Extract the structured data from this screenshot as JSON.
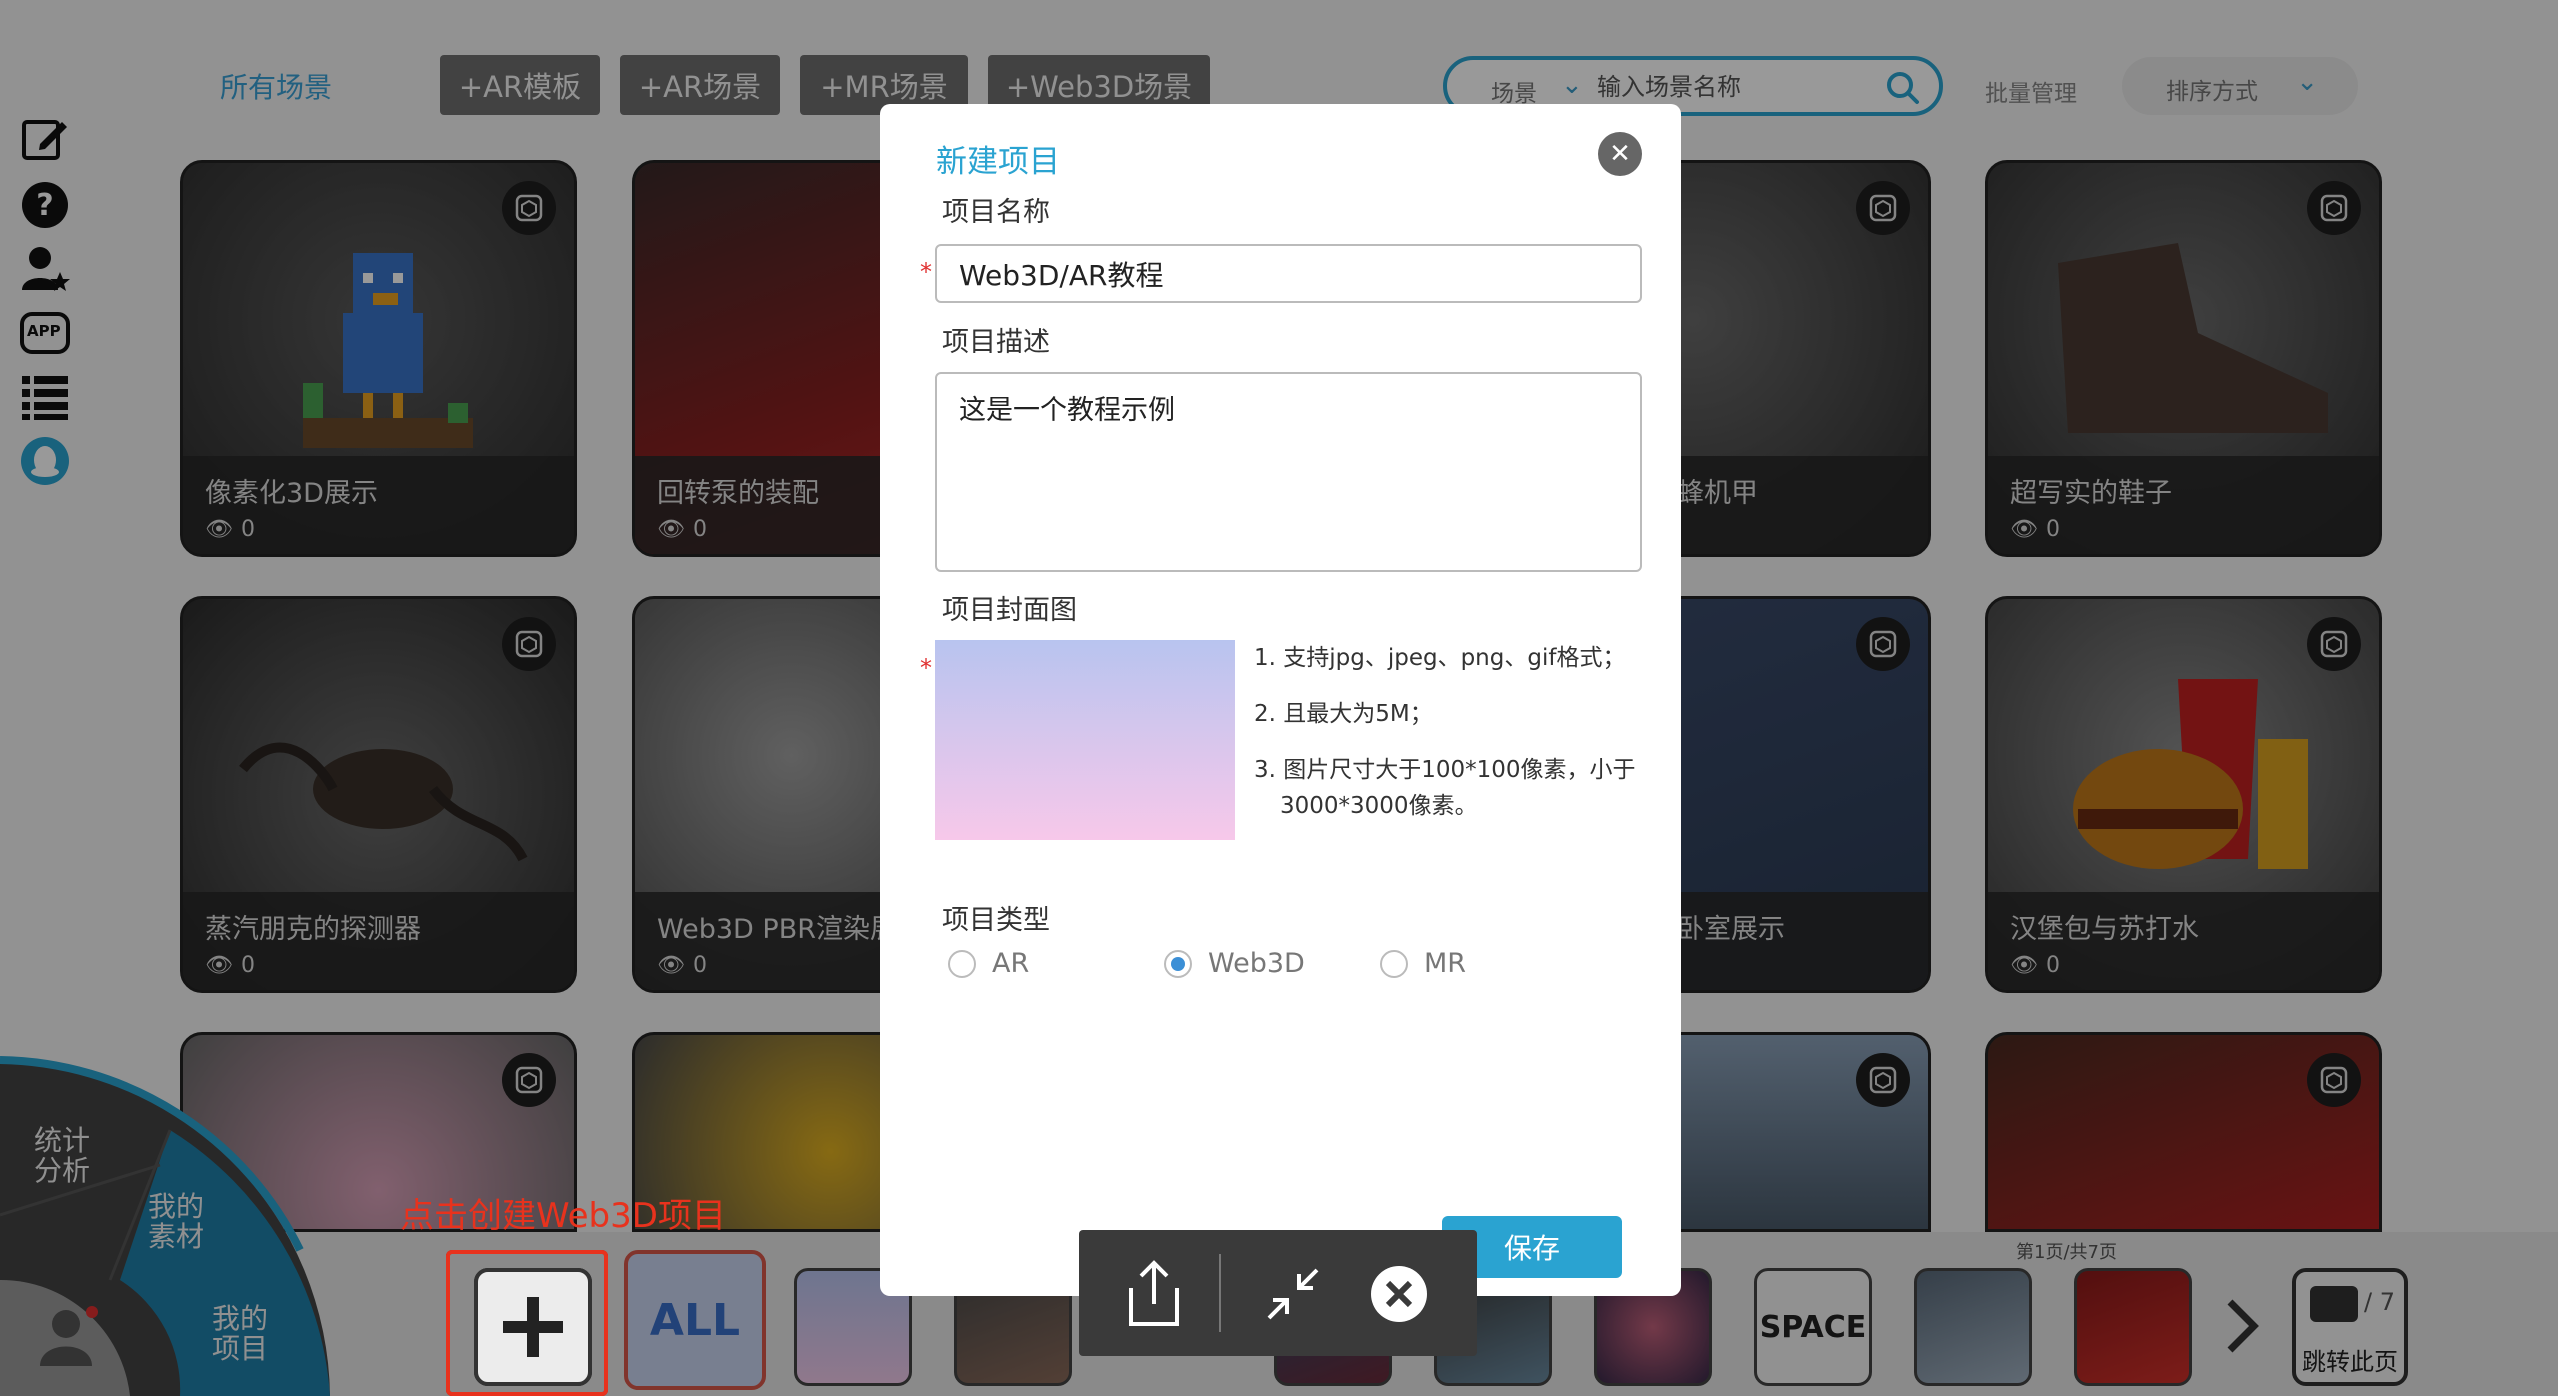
{
  "header": {
    "title": "所有场景",
    "buttons": [
      "+AR模板",
      "+AR场景",
      "+MR场景",
      "+Web3D场景"
    ],
    "search": {
      "scope": "场景",
      "placeholder": "输入场景名称"
    },
    "batch_label": "批量管理",
    "sort_label": "排序方式"
  },
  "sidebar": {
    "icons": [
      "edit-icon",
      "help-icon",
      "user-star-icon",
      "app-icon",
      "list-icon",
      "qq-icon"
    ],
    "app_text": "APP"
  },
  "cards": [
    {
      "title": "像素化3D展示",
      "views": "0"
    },
    {
      "title": "回转泵的装配",
      "views": "0"
    },
    {
      "title": "蜂机甲",
      "views": ""
    },
    {
      "title": "超写实的鞋子",
      "views": "0"
    },
    {
      "title": "蒸汽朋克的探测器",
      "views": "0"
    },
    {
      "title": "Web3D PBR渲染展",
      "views": "0"
    },
    {
      "title": "卧室展示",
      "views": ""
    },
    {
      "title": "汉堡包与苏打水",
      "views": "0"
    }
  ],
  "wheel": {
    "stats": "统计\n分析",
    "materials": "我的\n素材",
    "projects": "我的\n项目"
  },
  "hint_text": "点击创建Web3D项目",
  "strip": {
    "all_label": "ALL",
    "space_label": "SPACE",
    "page_info": "第1页/共7页",
    "page_total": "/ 7",
    "jump_label": "跳转此页"
  },
  "modal": {
    "title": "新建项目",
    "name_label": "项目名称",
    "name_value": "Web3D/AR教程",
    "desc_label": "项目描述",
    "desc_value": "这是一个教程示例",
    "cover_label": "项目封面图",
    "rules": [
      "1. 支持jpg、jpeg、png、gif格式；",
      "2. 且最大为5M；",
      "3. 图片尺寸大于100*100像素，小于",
      "3000*3000像素。"
    ],
    "type_label": "项目类型",
    "types": [
      {
        "label": "AR",
        "selected": false
      },
      {
        "label": "Web3D",
        "selected": true
      },
      {
        "label": "MR",
        "selected": false
      }
    ],
    "save_label": "保存"
  },
  "colors": {
    "accent": "#2aa3d1",
    "hint": "#e8321d",
    "radio_on": "#3b8fd6"
  }
}
